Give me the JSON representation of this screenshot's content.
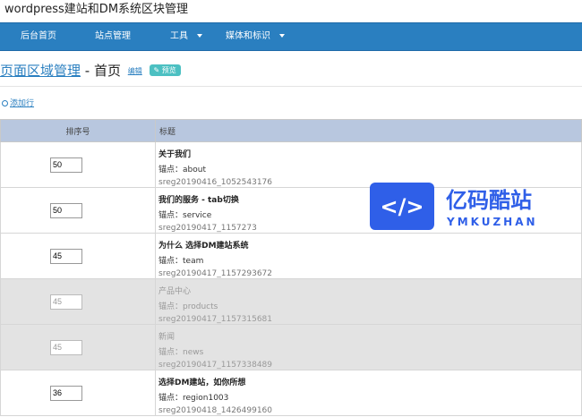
{
  "app": {
    "title": "wordpress建站和DM系统区块管理"
  },
  "nav": {
    "items": [
      {
        "label": "后台首页"
      },
      {
        "label": "站点管理"
      },
      {
        "label": "工具"
      },
      {
        "label": "媒体和标识"
      }
    ]
  },
  "page": {
    "title_link": "页面区域管理",
    "title_sep": " - 首页",
    "edit": "编辑",
    "preview": "预览",
    "add_row": "添加行"
  },
  "table": {
    "headers": [
      "排序号",
      "标题"
    ],
    "anchor_label": "锚点：",
    "rows": [
      {
        "order": "50",
        "title": "关于我们",
        "anchor": "about",
        "id": "sreg20190416_1052543176",
        "disabled": false
      },
      {
        "order": "50",
        "title": "我们的服务 - tab切换",
        "anchor": "service",
        "id": "sreg20190417_1157273",
        "disabled": false
      },
      {
        "order": "45",
        "title": "为什么 选择DM建站系统",
        "anchor": "team",
        "id": "sreg20190417_1157293672",
        "disabled": false
      },
      {
        "order": "45",
        "title": "产品中心",
        "anchor": "products",
        "id": "sreg20190417_1157315681",
        "disabled": true
      },
      {
        "order": "45",
        "title": "新闻",
        "anchor": "news",
        "id": "sreg20190417_1157338489",
        "disabled": true
      },
      {
        "order": "36",
        "title": "选择DM建站，如你所想",
        "anchor": "region1003",
        "id": "sreg20190418_1426499160",
        "disabled": false
      }
    ]
  },
  "watermark": {
    "name": "亿码酷站",
    "pinyin": "YMKUZHAN",
    "color": "#2f5fe8"
  }
}
